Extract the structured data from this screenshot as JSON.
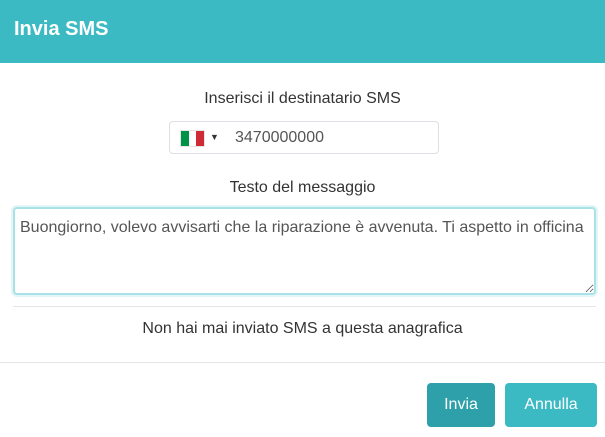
{
  "dialog": {
    "title": "Invia SMS"
  },
  "recipient": {
    "label": "Inserisci il destinatario SMS",
    "country": "it",
    "flag_colors": [
      "#009246",
      "#ffffff",
      "#ce2b37"
    ],
    "caret": "▼",
    "phone_value": "3470000000"
  },
  "message": {
    "label": "Testo del messaggio",
    "value": "Buongiorno, volevo avvisarti che la riparazione è avvenuta. Ti aspetto in officina"
  },
  "history_note": "Non hai mai inviato SMS a questa anagrafica",
  "footer": {
    "send_label": "Invia",
    "cancel_label": "Annulla"
  },
  "colors": {
    "header": "#3bbac3",
    "send_button": "#2da0a9",
    "cancel_button": "#3bbac3"
  }
}
